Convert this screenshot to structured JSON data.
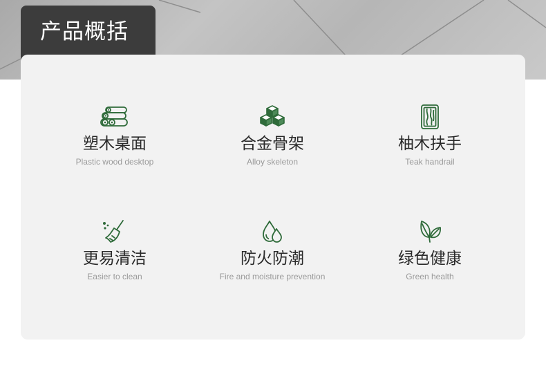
{
  "header": {
    "title": "产品概括"
  },
  "colors": {
    "tab_background": "#3c3c3c",
    "panel_background": "#f2f2f2",
    "icon_green": "#2f6b3a",
    "title_text": "#2a2a2a",
    "subtitle_text": "#9a9a9a"
  },
  "features": [
    {
      "icon": "log-stack-icon",
      "title": "塑木桌面",
      "subtitle": "Plastic wood desktop"
    },
    {
      "icon": "cubes-icon",
      "title": "合金骨架",
      "subtitle": "Alloy skeleton"
    },
    {
      "icon": "wood-board-icon",
      "title": "柚木扶手",
      "subtitle": "Teak handrail"
    },
    {
      "icon": "broom-icon",
      "title": "更易清洁",
      "subtitle": "Easier to clean"
    },
    {
      "icon": "water-drops-icon",
      "title": "防火防潮",
      "subtitle": "Fire and moisture prevention"
    },
    {
      "icon": "leaves-icon",
      "title": "绿色健康",
      "subtitle": "Green health"
    }
  ]
}
